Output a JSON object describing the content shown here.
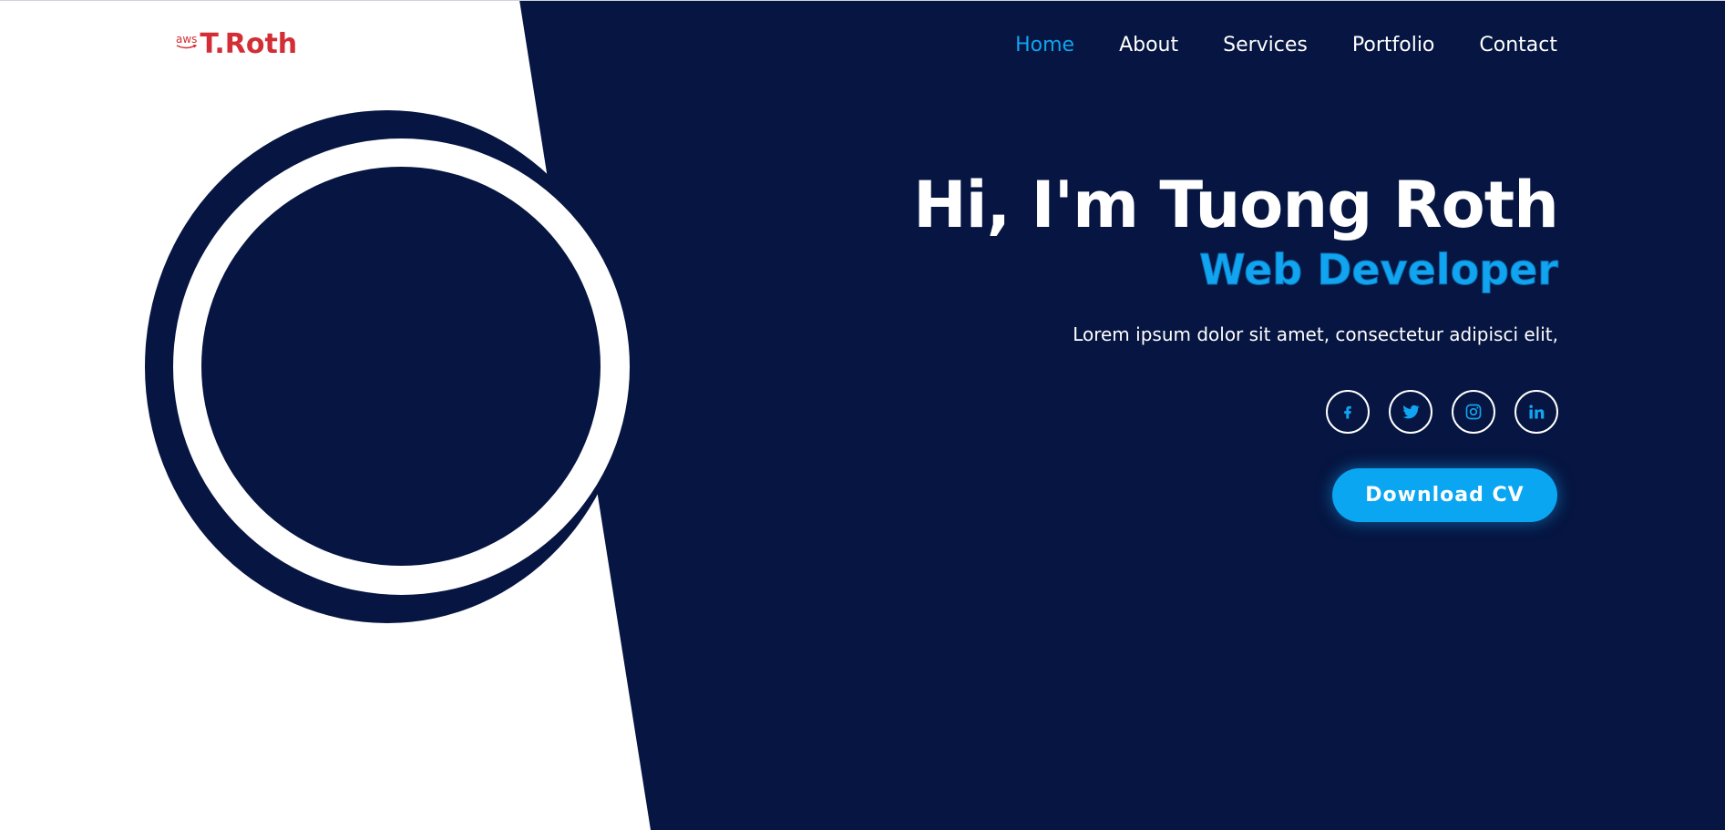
{
  "logo": {
    "aws": "aws",
    "name": "T.Roth"
  },
  "nav": {
    "items": [
      {
        "label": "Home",
        "active": true
      },
      {
        "label": "About"
      },
      {
        "label": "Services"
      },
      {
        "label": "Portfolio"
      },
      {
        "label": "Contact"
      }
    ]
  },
  "hero": {
    "greeting": "Hi, I'm Tuong Roth",
    "role": "Web Developer",
    "tagline": "Lorem ipsum dolor sit amet, consectetur adipisci elit,"
  },
  "socials": {
    "icons": [
      "facebook-icon",
      "twitter-icon",
      "instagram-icon",
      "linkedin-icon"
    ]
  },
  "cta": {
    "label": "Download CV"
  },
  "colors": {
    "navy": "#061541",
    "accent": "#11a4f0",
    "logo": "#d32d35",
    "white": "#ffffff"
  }
}
